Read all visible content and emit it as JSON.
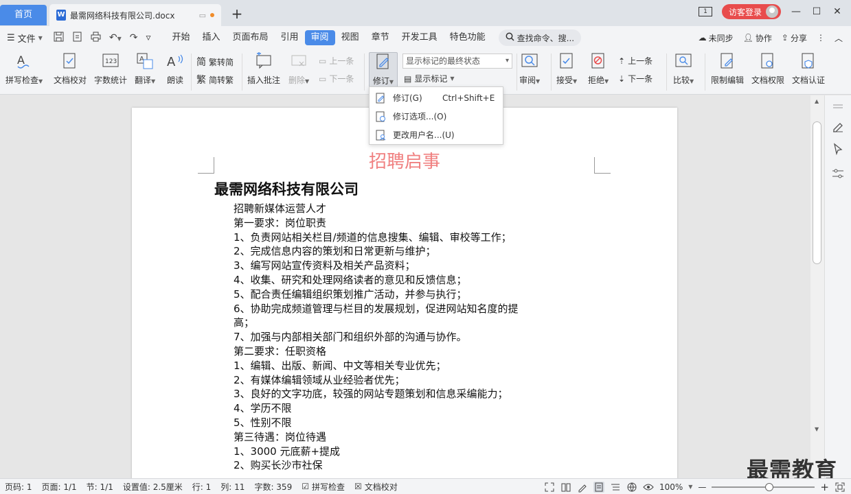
{
  "titlebar": {
    "home_tab": "首页",
    "doc_tab": "最需网络科技有限公司.docx",
    "new_tab": "+",
    "page_indicator": "1",
    "login": "访客登录"
  },
  "menubar": {
    "file": "文件",
    "tabs": [
      "开始",
      "插入",
      "页面布局",
      "引用",
      "审阅",
      "视图",
      "章节",
      "开发工具",
      "特色功能"
    ],
    "active_tab": "审阅",
    "search": "查找命令、搜...",
    "unsync": "未同步",
    "collab": "协作",
    "share": "分享"
  },
  "ribbon": {
    "spell_check": "拼写检查",
    "doc_proof": "文档校对",
    "word_count": "字数统计",
    "translate": "翻译",
    "read_aloud": "朗读",
    "trad_to_simp": "繁转简",
    "simp_to_trad": "简转繁",
    "insert_comment": "插入批注",
    "delete": "删除",
    "prev_comment": "上一条",
    "next_comment": "下一条",
    "track_changes": "修订",
    "markup_select": "显示标记的最终状态",
    "show_markup": "显示标记",
    "review": "审阅",
    "accept": "接受",
    "reject": "拒绝",
    "prev_change": "上一条",
    "next_change": "下一条",
    "compare": "比较",
    "restrict_edit": "限制编辑",
    "doc_rights": "文档权限",
    "doc_cert": "文档认证"
  },
  "dropdown": {
    "items": [
      {
        "label": "修订(G)",
        "shortcut": "Ctrl+Shift+E"
      },
      {
        "label": "修订选项...(O)",
        "shortcut": ""
      },
      {
        "label": "更改用户名...(U)",
        "shortcut": ""
      }
    ]
  },
  "document": {
    "header_title": "招聘启事",
    "company": "最需网络科技有限公司",
    "lines": [
      "招聘新媒体运营人才",
      "第一要求：岗位职责",
      "1、负责网站相关栏目/频道的信息搜集、编辑、审校等工作；",
      "2、完成信息内容的策划和日常更新与维护；",
      "3、编写网站宣传资料及相关产品资料；",
      "4、收集、研究和处理网络读者的意见和反馈信息；",
      "5、配合责任编辑组织策划推广活动，并参与执行；",
      "6、协助完成频道管理与栏目的发展规划，促进网站知名度的提",
      "高；",
      "7、加强与内部相关部门和组织外部的沟通与协作。",
      "第二要求：任职资格",
      "1、编辑、出版、新闻、中文等相关专业优先；",
      "2、有媒体编辑领域从业经验者优先；",
      "3、良好的文字功底，较强的网站专题策划和信息采编能力；",
      "4、学历不限",
      "5、性别不限",
      "第三待遇：岗位待遇",
      "1、3000 元底薪+提成",
      "2、购买长沙市社保"
    ]
  },
  "watermark": "最需教育",
  "statusbar": {
    "page_code": "页码: 1",
    "page": "页面: 1/1",
    "section": "节: 1/1",
    "setting": "设置值: 2.5厘米",
    "row": "行: 1",
    "col": "列: 11",
    "char_count": "字数: 359",
    "spell_check": "拼写检查",
    "doc_proof": "文档校对",
    "zoom": "100%",
    "zoom_level": 0.56
  },
  "colors": {
    "accent": "#4a8be8",
    "login": "#e84c4c",
    "header_title": "#f08080"
  }
}
